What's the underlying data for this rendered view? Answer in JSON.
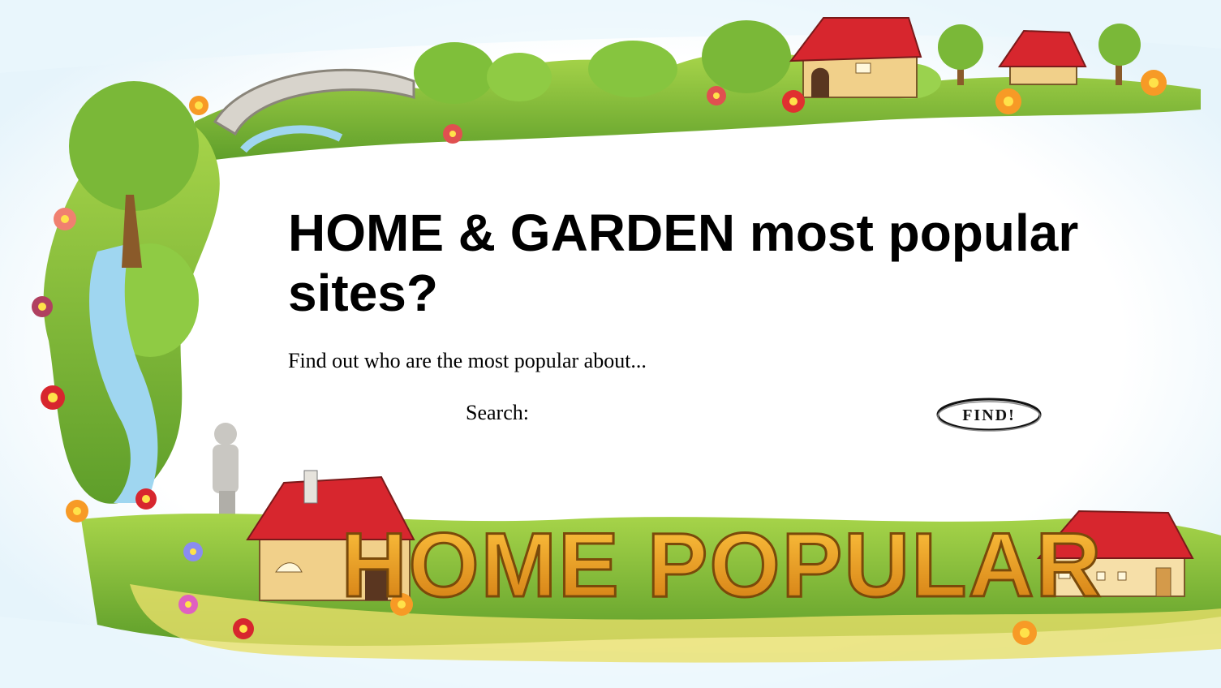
{
  "page": {
    "title": "HOME & GARDEN most popular sites?",
    "subtitle": "Find out who are the most popular about..."
  },
  "search": {
    "label": "Search:",
    "value": "",
    "placeholder": ""
  },
  "find_button": {
    "label": "FIND!"
  },
  "banner": {
    "logo_text": "HOME POPULAR"
  },
  "colors": {
    "grass": "#8cc63f",
    "roof": "#d7262e",
    "logo_orange": "#f0a020",
    "water": "#9fd6f0"
  }
}
